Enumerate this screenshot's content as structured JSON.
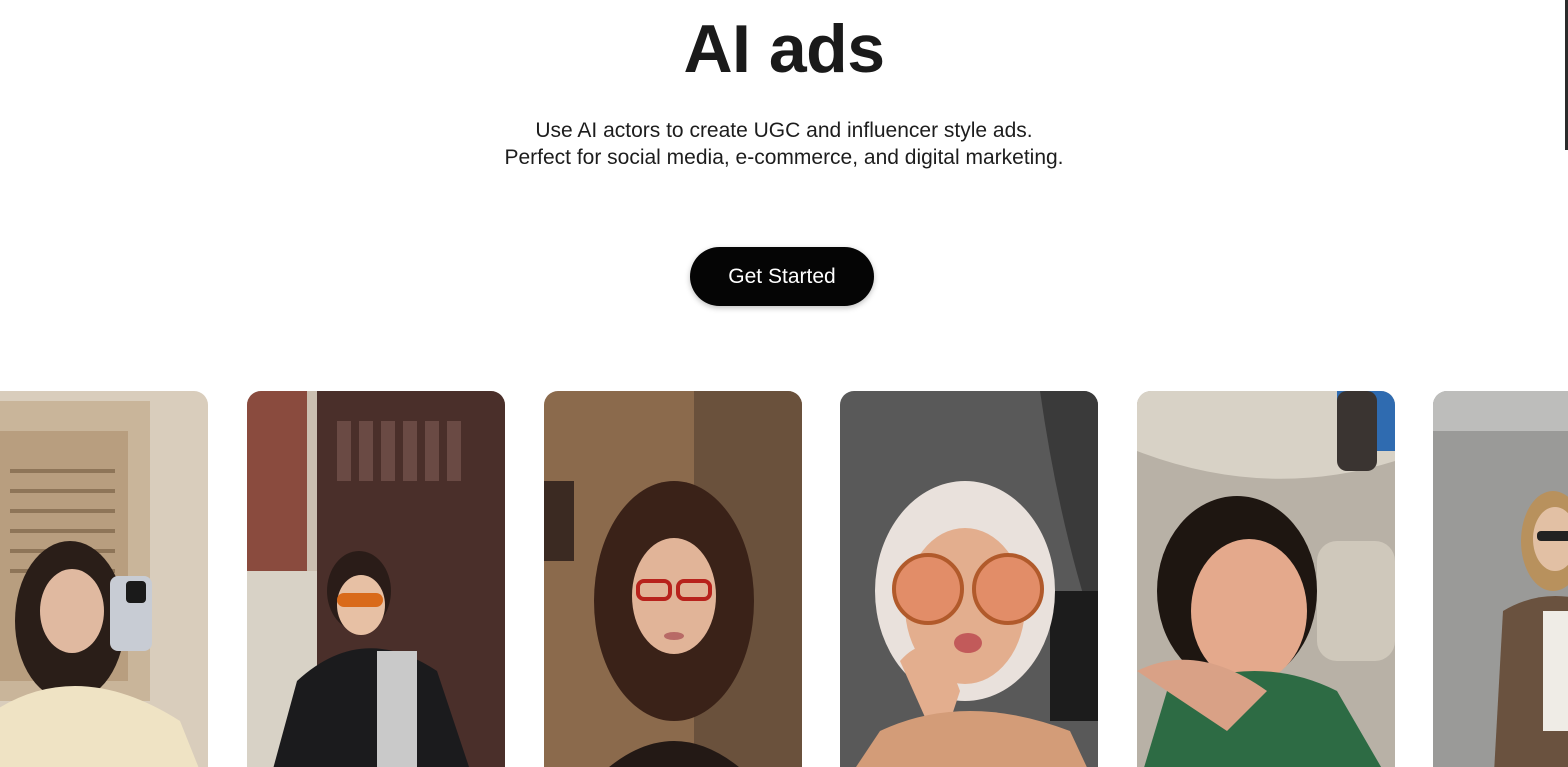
{
  "hero": {
    "title": "AI ads",
    "subtitle_line1": "Use AI actors to create UGC and influencer style ads.",
    "subtitle_line2": "Perfect for social media, e-commerce, and digital marketing."
  },
  "cta": {
    "label": "Get Started"
  },
  "gallery": {
    "cards": [
      {
        "name": "actor-mirror-selfie"
      },
      {
        "name": "actor-street-selfie"
      },
      {
        "name": "actor-glasses-portrait"
      },
      {
        "name": "actor-car-sunglasses"
      },
      {
        "name": "actor-car-smile"
      },
      {
        "name": "actor-standing-partial"
      }
    ]
  },
  "colors": {
    "cta_bg": "#050505",
    "cta_text": "#ffffff",
    "title": "#1a1a1a"
  }
}
